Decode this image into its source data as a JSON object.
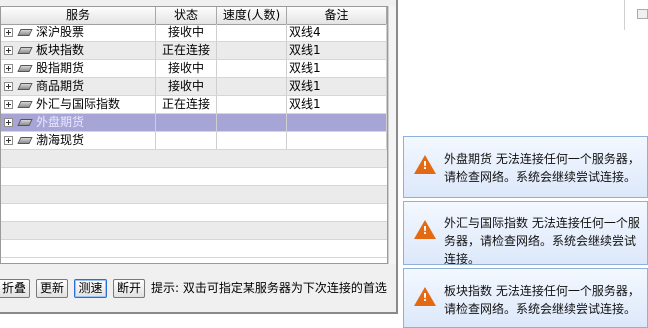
{
  "table": {
    "columns": [
      "服务",
      "状态",
      "速度(人数)",
      "备注"
    ],
    "rows": [
      {
        "name": "深沪股票",
        "status": "接收中",
        "speed": "",
        "note": "双线4",
        "selected": false
      },
      {
        "name": "板块指数",
        "status": "正在连接",
        "speed": "",
        "note": "双线1",
        "selected": false
      },
      {
        "name": "股指期货",
        "status": "接收中",
        "speed": "",
        "note": "双线1",
        "selected": false
      },
      {
        "name": "商品期货",
        "status": "接收中",
        "speed": "",
        "note": "双线1",
        "selected": false
      },
      {
        "name": "外汇与国际指数",
        "status": "正在连接",
        "speed": "",
        "note": "双线1",
        "selected": false
      },
      {
        "name": "外盘期货",
        "status": "",
        "speed": "",
        "note": "",
        "selected": true
      },
      {
        "name": "渤海现货",
        "status": "",
        "speed": "",
        "note": "",
        "selected": false
      }
    ]
  },
  "toolbar": {
    "collapse_label": "折叠",
    "refresh_label": "更新",
    "speedtest_label": "测速",
    "disconnect_label": "断开",
    "hint": "提示: 双击可指定某服务器为下次连接的首选"
  },
  "notifications": [
    {
      "message": "外盘期货 无法连接任何一个服务器，请检查网络。系统会继续尝试连接。",
      "icon": "warning-icon"
    },
    {
      "message": "外汇与国际指数 无法连接任何一个服务器，请检查网络。系统会继续尝试连接。",
      "icon": "warning-icon"
    },
    {
      "message": "板块指数 无法连接任何一个服务器，请检查网络。系统会继续尝试连接。",
      "icon": "warning-icon"
    }
  ],
  "colors": {
    "selected_row": "#a7a5d6",
    "warning": "#e36a12",
    "toast_border": "#8fb0db"
  }
}
